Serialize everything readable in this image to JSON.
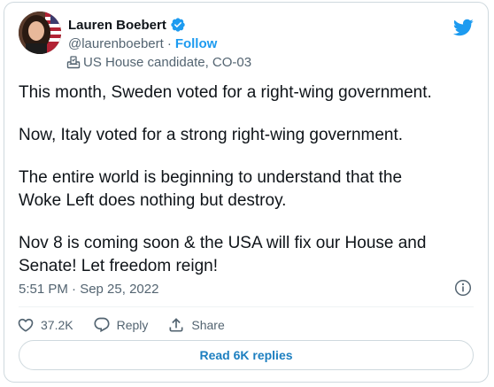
{
  "author": {
    "display_name": "Lauren Boebert",
    "handle": "@laurenboebert",
    "separator": "·",
    "follow_label": "Follow",
    "account_label": "US House candidate, CO-03",
    "verified": true
  },
  "tweet": {
    "paragraphs": [
      "This month, Sweden voted for a right-wing government.",
      "Now, Italy voted for a strong right-wing government.",
      "The entire world is beginning to understand that the\nWoke Left does nothing but destroy.",
      "Nov 8 is coming soon & the USA will fix our House and\nSenate! Let freedom reign!"
    ],
    "timestamp": "5:51 PM · Sep 25, 2022"
  },
  "actions": {
    "like_count": "37.2K",
    "reply_label": "Reply",
    "share_label": "Share"
  },
  "footer": {
    "read_replies_label": "Read 6K replies"
  },
  "colors": {
    "accent": "#1d9bf0",
    "secondary_text": "#536471",
    "border": "#cfd9de"
  },
  "icons": [
    "verified-badge-icon",
    "twitter-bird-icon",
    "ballot-box-icon",
    "info-icon",
    "heart-icon",
    "speech-bubble-icon",
    "share-icon"
  ]
}
